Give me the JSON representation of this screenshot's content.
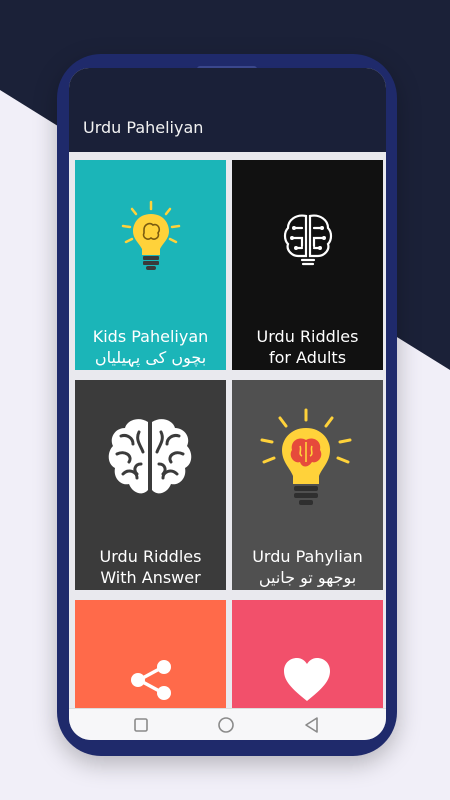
{
  "app": {
    "title": "Urdu Paheliyan"
  },
  "cards": [
    {
      "line1": "Kids Paheliyan",
      "line2": "بچوں کی پہیلیاں",
      "color": "#1bb5b8",
      "icon": "lightbulb-brain-icon"
    },
    {
      "line1": "Urdu Riddles",
      "line2": "for Adults",
      "color": "#111111",
      "icon": "circuit-brain-icon"
    },
    {
      "line1": "Urdu Riddles",
      "line2": "With Answer",
      "color": "#3b3b3b",
      "icon": "brain-icon"
    },
    {
      "line1": "Urdu Pahylian",
      "line2": "بوجھو تو جانیں",
      "color": "#505050",
      "icon": "idea-bulb-icon"
    },
    {
      "color": "#ff6a4a",
      "icon": "share-icon"
    },
    {
      "color": "#f2506b",
      "icon": "heart-icon"
    }
  ],
  "navbar": {
    "icons": [
      "square-icon",
      "circle-icon",
      "back-triangle-icon"
    ]
  }
}
